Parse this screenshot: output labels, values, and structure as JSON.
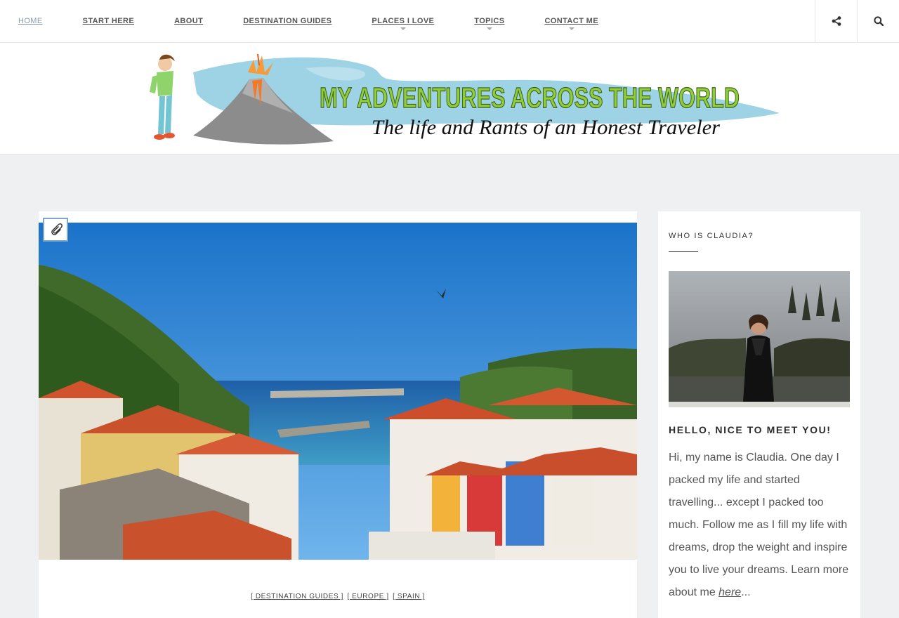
{
  "nav": {
    "items": [
      {
        "label": "HOME",
        "active": true,
        "dropdown": false
      },
      {
        "label": "START HERE",
        "active": false,
        "dropdown": false
      },
      {
        "label": "ABOUT",
        "active": false,
        "dropdown": false
      },
      {
        "label": "DESTINATION GUIDES",
        "active": false,
        "dropdown": false
      },
      {
        "label": "PLACES I LOVE",
        "active": false,
        "dropdown": true
      },
      {
        "label": "TOPICS",
        "active": false,
        "dropdown": true
      },
      {
        "label": "CONTACT ME",
        "active": false,
        "dropdown": true
      }
    ],
    "share_icon": "share-icon",
    "search_icon": "search-icon"
  },
  "banner": {
    "title": "MY ADVENTURES ACROSS THE WORLD",
    "tagline": "The life and Rants of an Honest Traveler"
  },
  "post": {
    "format_icon": "paperclip-icon",
    "categories": [
      "[ DESTINATION GUIDES ]",
      "[ EUROPE ]",
      "[ SPAIN ]"
    ]
  },
  "sidebar": {
    "widget_title": "WHO IS CLAUDIA?",
    "hello_title": "HELLO, NICE TO MEET YOU!",
    "bio_text": "Hi, my name is Claudia. One day I packed my life and started travelling... except I packed too much. Follow me as I fill my life with dreams, drop the weight and inspire you to live your dreams. Learn more about me ",
    "bio_link": "here",
    "bio_suffix": "..."
  },
  "colors": {
    "nav_active": "#8a9aab",
    "banner_title_green": "#8fce3a",
    "banner_swoosh_blue": "#7fc6dd",
    "page_background": "#eef0f2"
  }
}
